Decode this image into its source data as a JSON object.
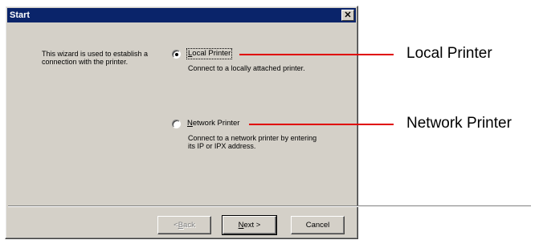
{
  "dialog": {
    "title": "Start",
    "close_glyph": "✕",
    "description": "This wizard is used to establish a connection with the printer.",
    "options": [
      {
        "accel": "L",
        "rest": "ocal Printer",
        "selected": true,
        "description": "Connect to a locally attached printer."
      },
      {
        "accel": "N",
        "rest": "etwork Printer",
        "selected": false,
        "description": "Connect to a network printer by entering its IP or IPX address."
      }
    ],
    "buttons": {
      "back_prefix": "< ",
      "back_accel": "B",
      "back_rest": "ack",
      "back_enabled": false,
      "next_accel": "N",
      "next_rest": "ext >",
      "cancel": "Cancel"
    }
  },
  "callouts": {
    "local": "Local Printer",
    "network": "Network Printer",
    "line_color": "#e00000"
  }
}
